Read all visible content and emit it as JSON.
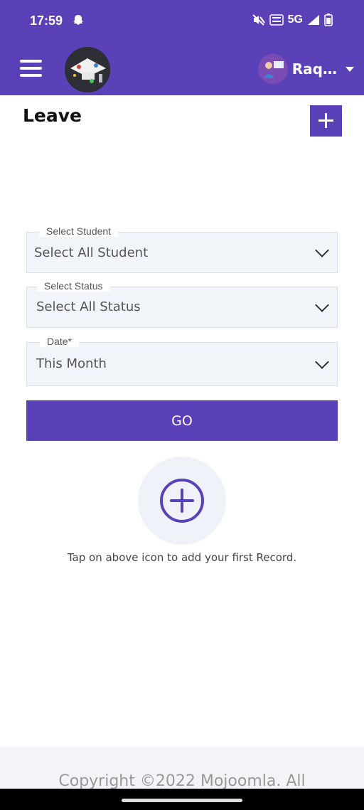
{
  "status_bar": {
    "time": "17:59",
    "network": "5G",
    "icons": [
      "snapchat-icon",
      "mute-icon",
      "volte-icon",
      "signal-icon",
      "battery-icon"
    ]
  },
  "app_bar": {
    "user_name": "Raq…",
    "icons": [
      "menu-icon",
      "school-logo",
      "avatar",
      "dropdown-icon"
    ],
    "color": "#5a41b8"
  },
  "page": {
    "title": "Leave",
    "add_icon": "plus-icon"
  },
  "filters": {
    "student": {
      "label": "Select Student",
      "value": "Select All Student"
    },
    "status": {
      "label": "Select Status",
      "value": "Select All Status"
    },
    "date": {
      "label": "Date*",
      "value": "This Month"
    }
  },
  "go_button": {
    "label": "GO"
  },
  "empty_state": {
    "icon": "add-circle-icon",
    "text": "Tap on above icon to add your first Record."
  },
  "footer": {
    "copyright": "Copyright ©2022 Mojoomla. All"
  }
}
